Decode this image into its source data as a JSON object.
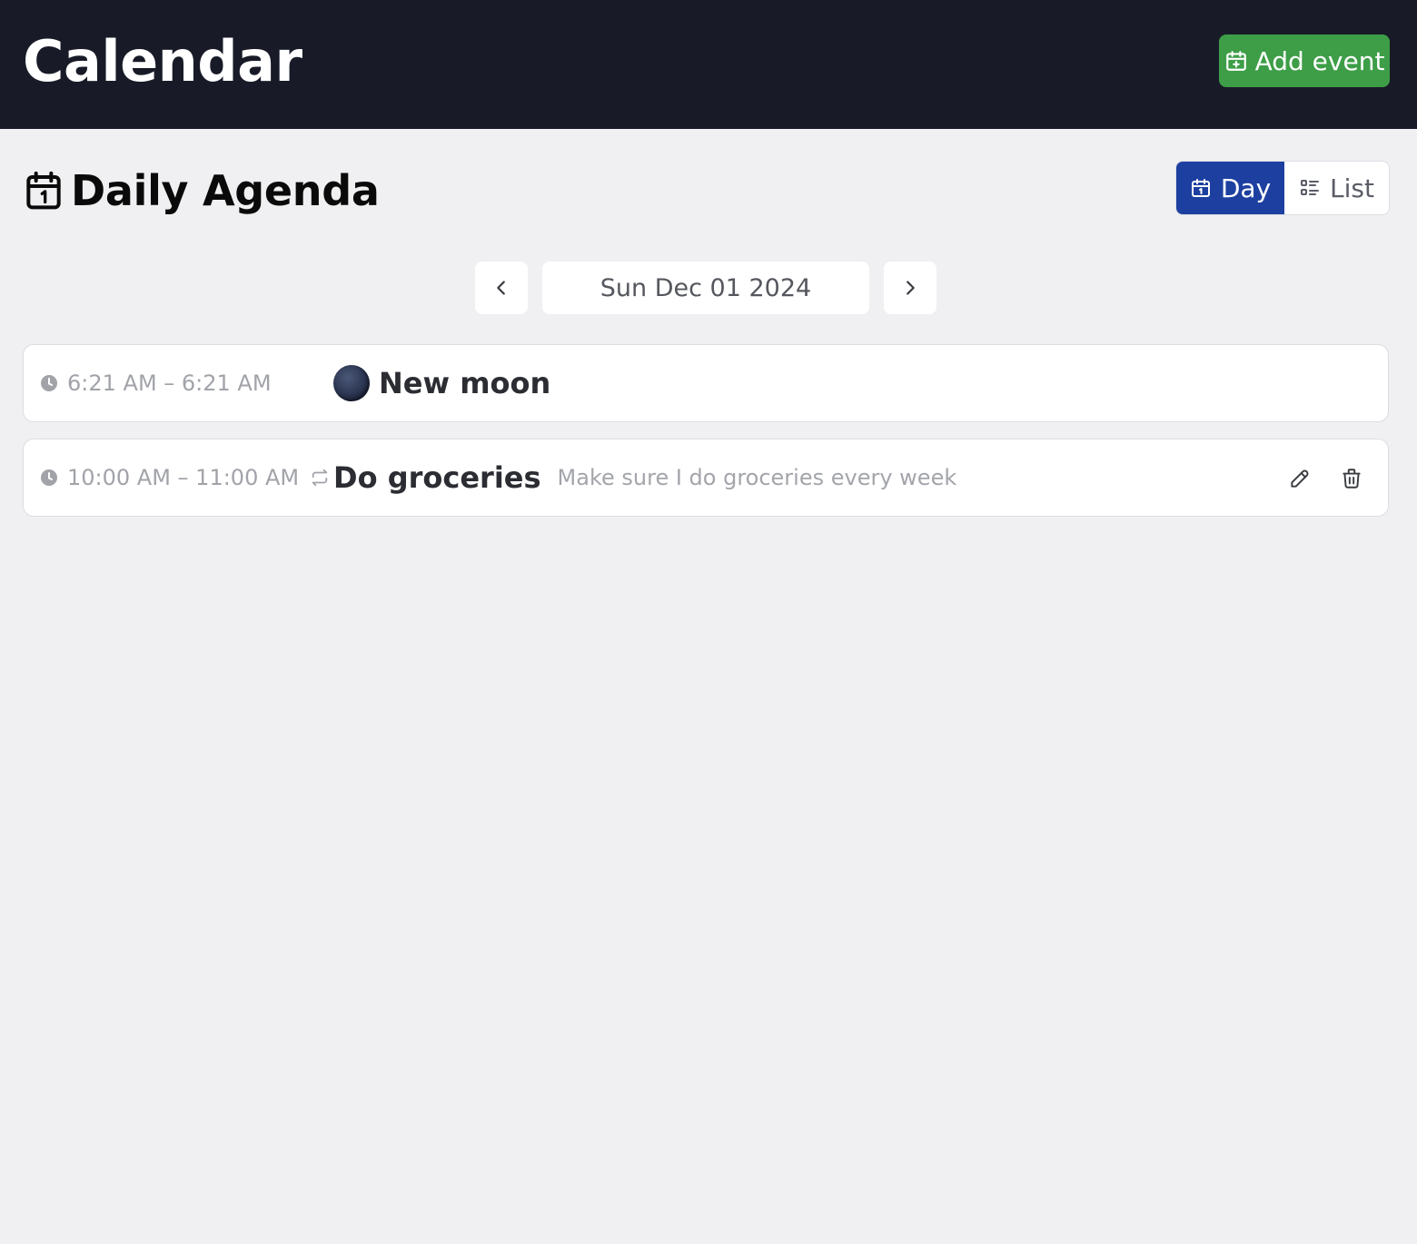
{
  "header": {
    "title": "Calendar",
    "add_label": "Add event"
  },
  "agenda": {
    "title": "Daily Agenda",
    "views": {
      "day": "Day",
      "list": "List",
      "active": "day"
    }
  },
  "date_nav": {
    "date": "Sun Dec 01 2024"
  },
  "events": [
    {
      "time": "6:21 AM – 6:21 AM",
      "title": "New moon",
      "icon": "new-moon-icon",
      "repeats": false
    },
    {
      "time": "10:00 AM – 11:00 AM",
      "title": "Do groceries",
      "description": "Make sure I do groceries every week",
      "repeats": true
    }
  ],
  "colors": {
    "header_bg": "#181b27",
    "add_button": "#3d9e47",
    "active_view": "#1d40a0",
    "page_bg": "#f0f0f2"
  }
}
